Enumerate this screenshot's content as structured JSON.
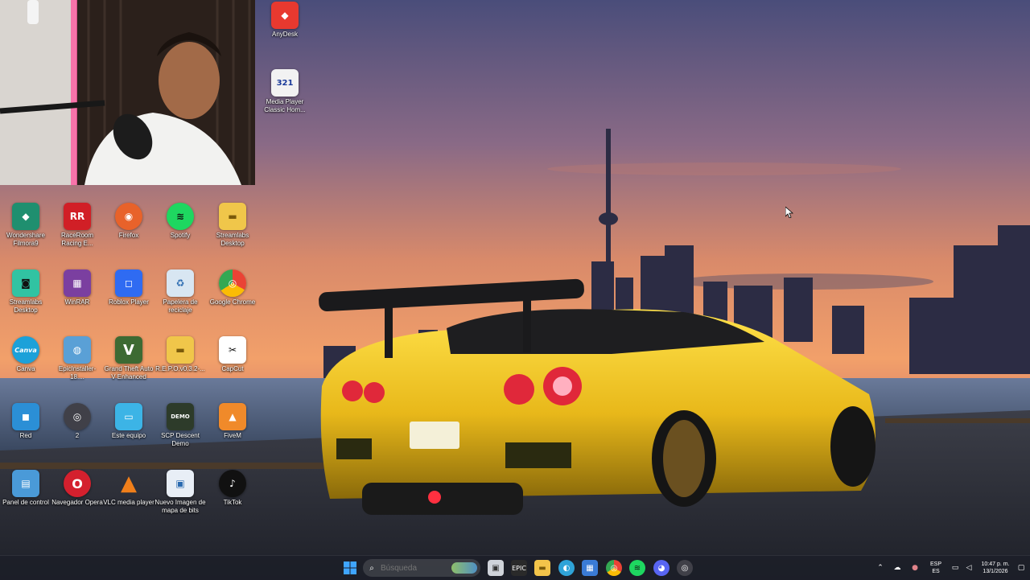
{
  "desktop": {
    "icons": [
      {
        "label": "AnyDesk",
        "glyph": "◆",
        "color": "#e8392f",
        "icon": "anydesk-icon"
      },
      {
        "label": "Media Player Classic Hom...",
        "glyph": "321",
        "color": "#f2f2f2",
        "icon": "media-player-classic-icon"
      },
      {
        "label": "Wondershare Filmora9",
        "glyph": "◆",
        "color": "#1f8f6f",
        "icon": "filmora-icon"
      },
      {
        "label": "RaceRoom Racing E...",
        "glyph": "RR",
        "color": "#d11f26",
        "icon": "raceroom-icon"
      },
      {
        "label": "Firefox",
        "glyph": "◉",
        "color": "#e8622a",
        "icon": "firefox-icon"
      },
      {
        "label": "Spotify",
        "glyph": "≋",
        "color": "#1ed760",
        "icon": "spotify-icon"
      },
      {
        "label": "Streamlabs Desktop",
        "glyph": "▬",
        "color": "#f0c64a",
        "icon": "folder-icon"
      },
      {
        "label": "Streamlabs Desktop",
        "glyph": "◙",
        "color": "#31c3a2",
        "icon": "streamlabs-icon"
      },
      {
        "label": "WinRAR",
        "glyph": "▦",
        "color": "#7b3fa0",
        "icon": "winrar-icon"
      },
      {
        "label": "Roblox Player",
        "glyph": "◻",
        "color": "#2f6bf2",
        "icon": "roblox-icon"
      },
      {
        "label": "Papelera de reciclaje",
        "glyph": "♻",
        "color": "#d8e6f2",
        "icon": "recycle-bin-icon"
      },
      {
        "label": "Google Chrome",
        "glyph": "◎",
        "color": "#ea4335",
        "icon": "chrome-icon"
      },
      {
        "label": "Canva",
        "glyph": "Canva",
        "color": "#1ca1d9",
        "icon": "canva-icon"
      },
      {
        "label": "EpicInstaller-18....",
        "glyph": "◍",
        "color": "#5aa0d6",
        "icon": "disc-installer-icon"
      },
      {
        "label": "Grand Theft Auto V Enhanced",
        "glyph": "V",
        "color": "#3d6a33",
        "icon": "gta-v-icon"
      },
      {
        "label": "R.E.P.O.v0.3.2-...",
        "glyph": "▬",
        "color": "#f0c64a",
        "icon": "folder-icon"
      },
      {
        "label": "CapCut",
        "glyph": "✂",
        "color": "#ffffff",
        "icon": "capcut-icon"
      },
      {
        "label": "Red",
        "glyph": "◼",
        "color": "#2b8fd6",
        "icon": "network-icon"
      },
      {
        "label": "2",
        "glyph": "◎",
        "color": "#404048",
        "icon": "obs-icon"
      },
      {
        "label": "Este equipo",
        "glyph": "▭",
        "color": "#3cb4e6",
        "icon": "this-pc-icon"
      },
      {
        "label": "SCP Descent Demo",
        "glyph": "DEMO",
        "color": "#2d3b2a",
        "icon": "scp-descent-icon"
      },
      {
        "label": "FiveM",
        "glyph": "▲",
        "color": "#f08a2a",
        "icon": "fivem-icon"
      },
      {
        "label": "Panel de control",
        "glyph": "▤",
        "color": "#4a9ad8",
        "icon": "control-panel-icon"
      },
      {
        "label": "Navegador Opera",
        "glyph": "O",
        "color": "#d4202e",
        "icon": "opera-icon"
      },
      {
        "label": "VLC media player",
        "glyph": "▲",
        "color": "#f07f1a",
        "icon": "vlc-icon"
      },
      {
        "label": "Nuevo Imagen de mapa de bits",
        "glyph": "▣",
        "color": "#e8eef6",
        "icon": "bitmap-file-icon"
      },
      {
        "label": "TikTok",
        "glyph": "♪",
        "color": "#111111",
        "icon": "tiktok-icon"
      }
    ]
  },
  "taskbar": {
    "search_placeholder": "Búsqueda",
    "apps": [
      {
        "icon": "start-icon",
        "glyph": "⊞",
        "color": "#3fa5ff"
      },
      {
        "icon": "task-view-icon",
        "glyph": "▣",
        "color": "#cfd3da"
      },
      {
        "icon": "epic-games-icon",
        "glyph": "E",
        "color": "#2a2a2a"
      },
      {
        "icon": "file-explorer-icon",
        "glyph": "▬",
        "color": "#f3c44a"
      },
      {
        "icon": "edge-icon",
        "glyph": "◐",
        "color": "#2fa3d8"
      },
      {
        "icon": "store-icon",
        "glyph": "▦",
        "color": "#3a7bd5"
      },
      {
        "icon": "chrome-taskbar-icon",
        "glyph": "◎",
        "color": "#ea4335"
      },
      {
        "icon": "spotify-taskbar-icon",
        "glyph": "≋",
        "color": "#1ed760"
      },
      {
        "icon": "discord-taskbar-icon",
        "glyph": "◕",
        "color": "#5865f2"
      },
      {
        "icon": "obs-taskbar-icon",
        "glyph": "◎",
        "color": "#404048"
      }
    ],
    "tray": {
      "language_top": "ESP",
      "language_bottom": "ES",
      "time": "10:47 p. m.",
      "date": "13/1/2026"
    }
  }
}
